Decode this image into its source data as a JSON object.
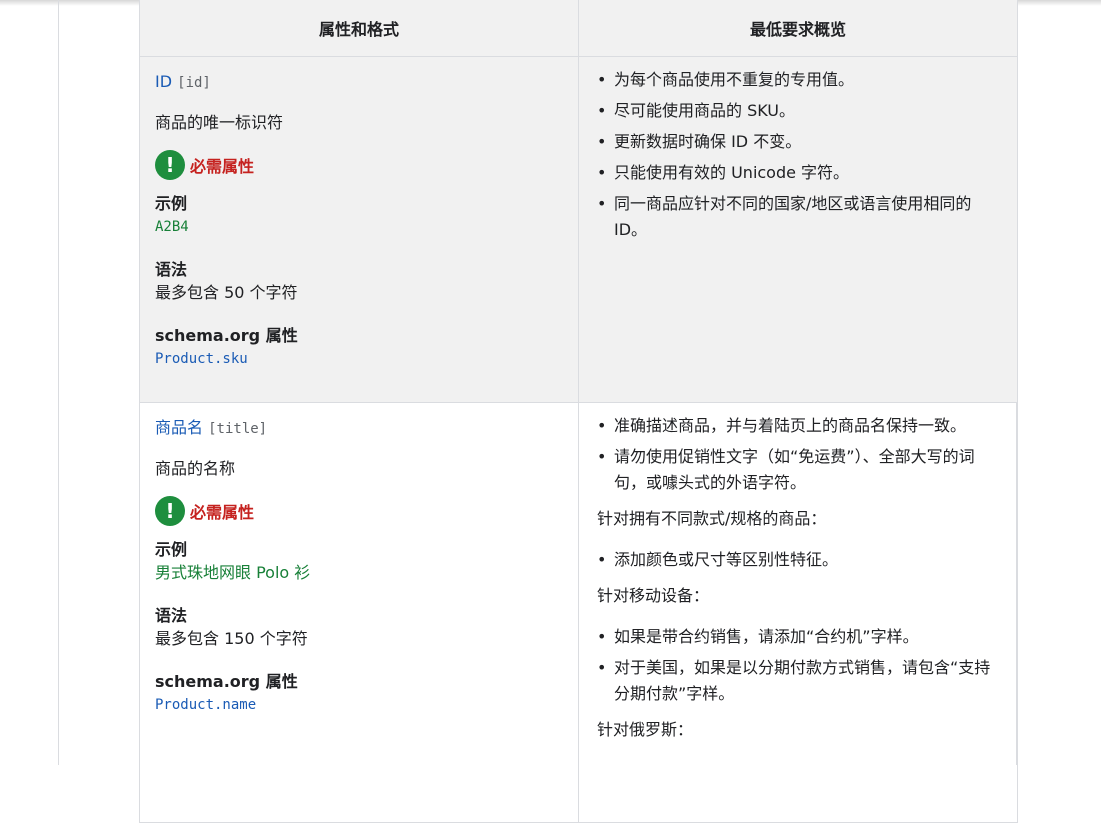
{
  "table": {
    "headers": [
      "属性和格式",
      "最低要求概览"
    ],
    "rows": [
      {
        "attr_name": "ID",
        "attr_code": "[id]",
        "description": "商品的唯一标识符",
        "required_label": "必需属性",
        "example_title": "示例",
        "example_value": "A2B4",
        "syntax_title": "语法",
        "syntax_value": "最多包含 50 个字符",
        "schema_title": "schema.org 属性",
        "schema_value": "Product.sku",
        "requirements": [
          "为每个商品使用不重复的专用值。",
          "尽可能使用商品的 SKU。",
          "更新数据时确保 ID 不变。",
          "只能使用有效的 Unicode 字符。",
          "同一商品应针对不同的国家/地区或语言使用相同的 ID。"
        ]
      },
      {
        "attr_name": "商品名",
        "attr_code": "[title]",
        "description": "商品的名称",
        "required_label": "必需属性",
        "example_title": "示例",
        "example_value": "男式珠地网眼 Polo 衫",
        "syntax_title": "语法",
        "syntax_value": "最多包含 150 个字符",
        "schema_title": "schema.org 属性",
        "schema_value": "Product.name",
        "requirements": [
          "准确描述商品，并与着陆页上的商品名保持一致。",
          "请勿使用促销性文字（如“免运费”）、全部大写的词句，或噱头式的外语字符。"
        ],
        "variants_heading": "针对拥有不同款式/规格的商品：",
        "variants_items": [
          "添加颜色或尺寸等区别性特征。"
        ],
        "mobile_heading": "针对移动设备：",
        "mobile_items": [
          "如果是带合约销售，请添加“合约机”字样。",
          "对于美国，如果是以分期付款方式销售，请包含“支持分期付款”字样。"
        ],
        "russia_heading": "针对俄罗斯："
      }
    ]
  }
}
